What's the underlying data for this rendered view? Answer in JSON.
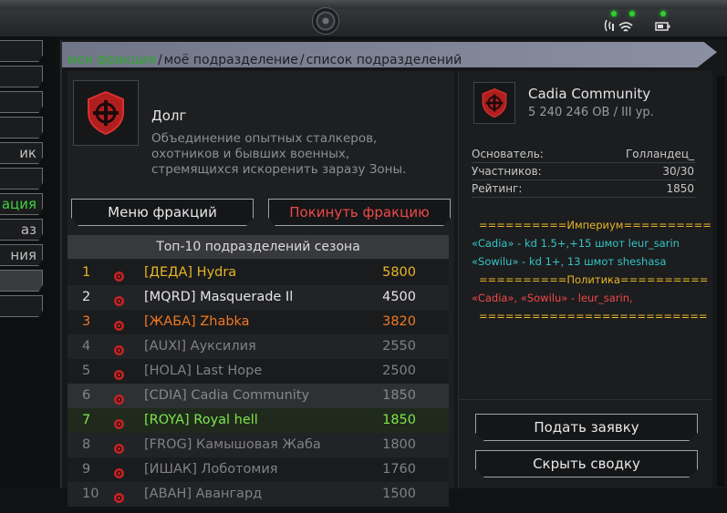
{
  "side_menu": [
    {
      "label": ""
    },
    {
      "label": ""
    },
    {
      "label": ""
    },
    {
      "label": ""
    },
    {
      "label": "ик"
    },
    {
      "label": ""
    },
    {
      "label": "ация",
      "state": "active"
    },
    {
      "label": "аз"
    },
    {
      "label": "ния"
    },
    {
      "label": "",
      "state": "selected"
    },
    {
      "label": ""
    }
  ],
  "breadcrumb": {
    "item1": "моя фракция",
    "sep": "/",
    "item2": "моё подразделение",
    "item3": "список подразделений"
  },
  "faction": {
    "name": "Долг",
    "description": "Объединение опытных сталкеров, охотников и бывших военных, стремящихся искоренить заразу Зоны.",
    "menu_button": "Меню фракций",
    "leave_button": "Покинуть фракцию"
  },
  "top_list": {
    "title": "Топ-10 подразделений сезона",
    "rows": [
      {
        "rank": "1",
        "name": "[ДЕДА] Hydra",
        "score": "5800",
        "style": "gold"
      },
      {
        "rank": "2",
        "name": "[MQRD] Masquerade Il",
        "score": "4500",
        "style": "white"
      },
      {
        "rank": "3",
        "name": "[ЖАБА] Zhabka",
        "score": "3820",
        "style": "orange"
      },
      {
        "rank": "4",
        "name": "[AUXI] Ауксилия",
        "score": "2550",
        "style": "grey"
      },
      {
        "rank": "5",
        "name": "[HOLA] Last Hope",
        "score": "2500",
        "style": "grey"
      },
      {
        "rank": "6",
        "name": "[CDIA] Cadia Community",
        "score": "1850",
        "style": "self"
      },
      {
        "rank": "7",
        "name": "[ROYA] Royal hell",
        "score": "1850",
        "style": "green"
      },
      {
        "rank": "8",
        "name": "[FROG] Камышовая Жаба",
        "score": "1800",
        "style": "grey"
      },
      {
        "rank": "9",
        "name": "[ИШАК] Лоботомия",
        "score": "1760",
        "style": "grey"
      },
      {
        "rank": "10",
        "name": "[АВАН] Авангард",
        "score": "1500",
        "style": "grey"
      }
    ]
  },
  "community": {
    "name": "Cadia Community",
    "subtitle": "5 240 246 OB / III ур.",
    "founder_label": "Основатель:",
    "founder_value": "Голландец_",
    "members_label": "Участников:",
    "members_value": "30/30",
    "rating_label": "Рейтинг:",
    "rating_value": "1850",
    "notes": [
      {
        "text": "==========Империум==========",
        "color": "#e8b628"
      },
      {
        "text": "«Cadia» - kd 1.5+,+15 шмот leur_sarin",
        "color": "#35c4c4"
      },
      {
        "text": "«Sowilu» - kd 1+, 13 шмот sheshasa",
        "color": "#35c4c4"
      },
      {
        "text": "==========Политика==========",
        "color": "#e8b628"
      },
      {
        "text": "«Cadia», «Sowilu» - leur_sarin,",
        "color": "#f04848"
      },
      {
        "text": "==========================",
        "color": "#e8b628"
      }
    ],
    "apply_button": "Подать заявку",
    "hide_button": "Скрыть сводку"
  },
  "colors": {
    "accent_green": "#3dd33d",
    "danger_red": "#f04848",
    "gold": "#e8b628"
  }
}
